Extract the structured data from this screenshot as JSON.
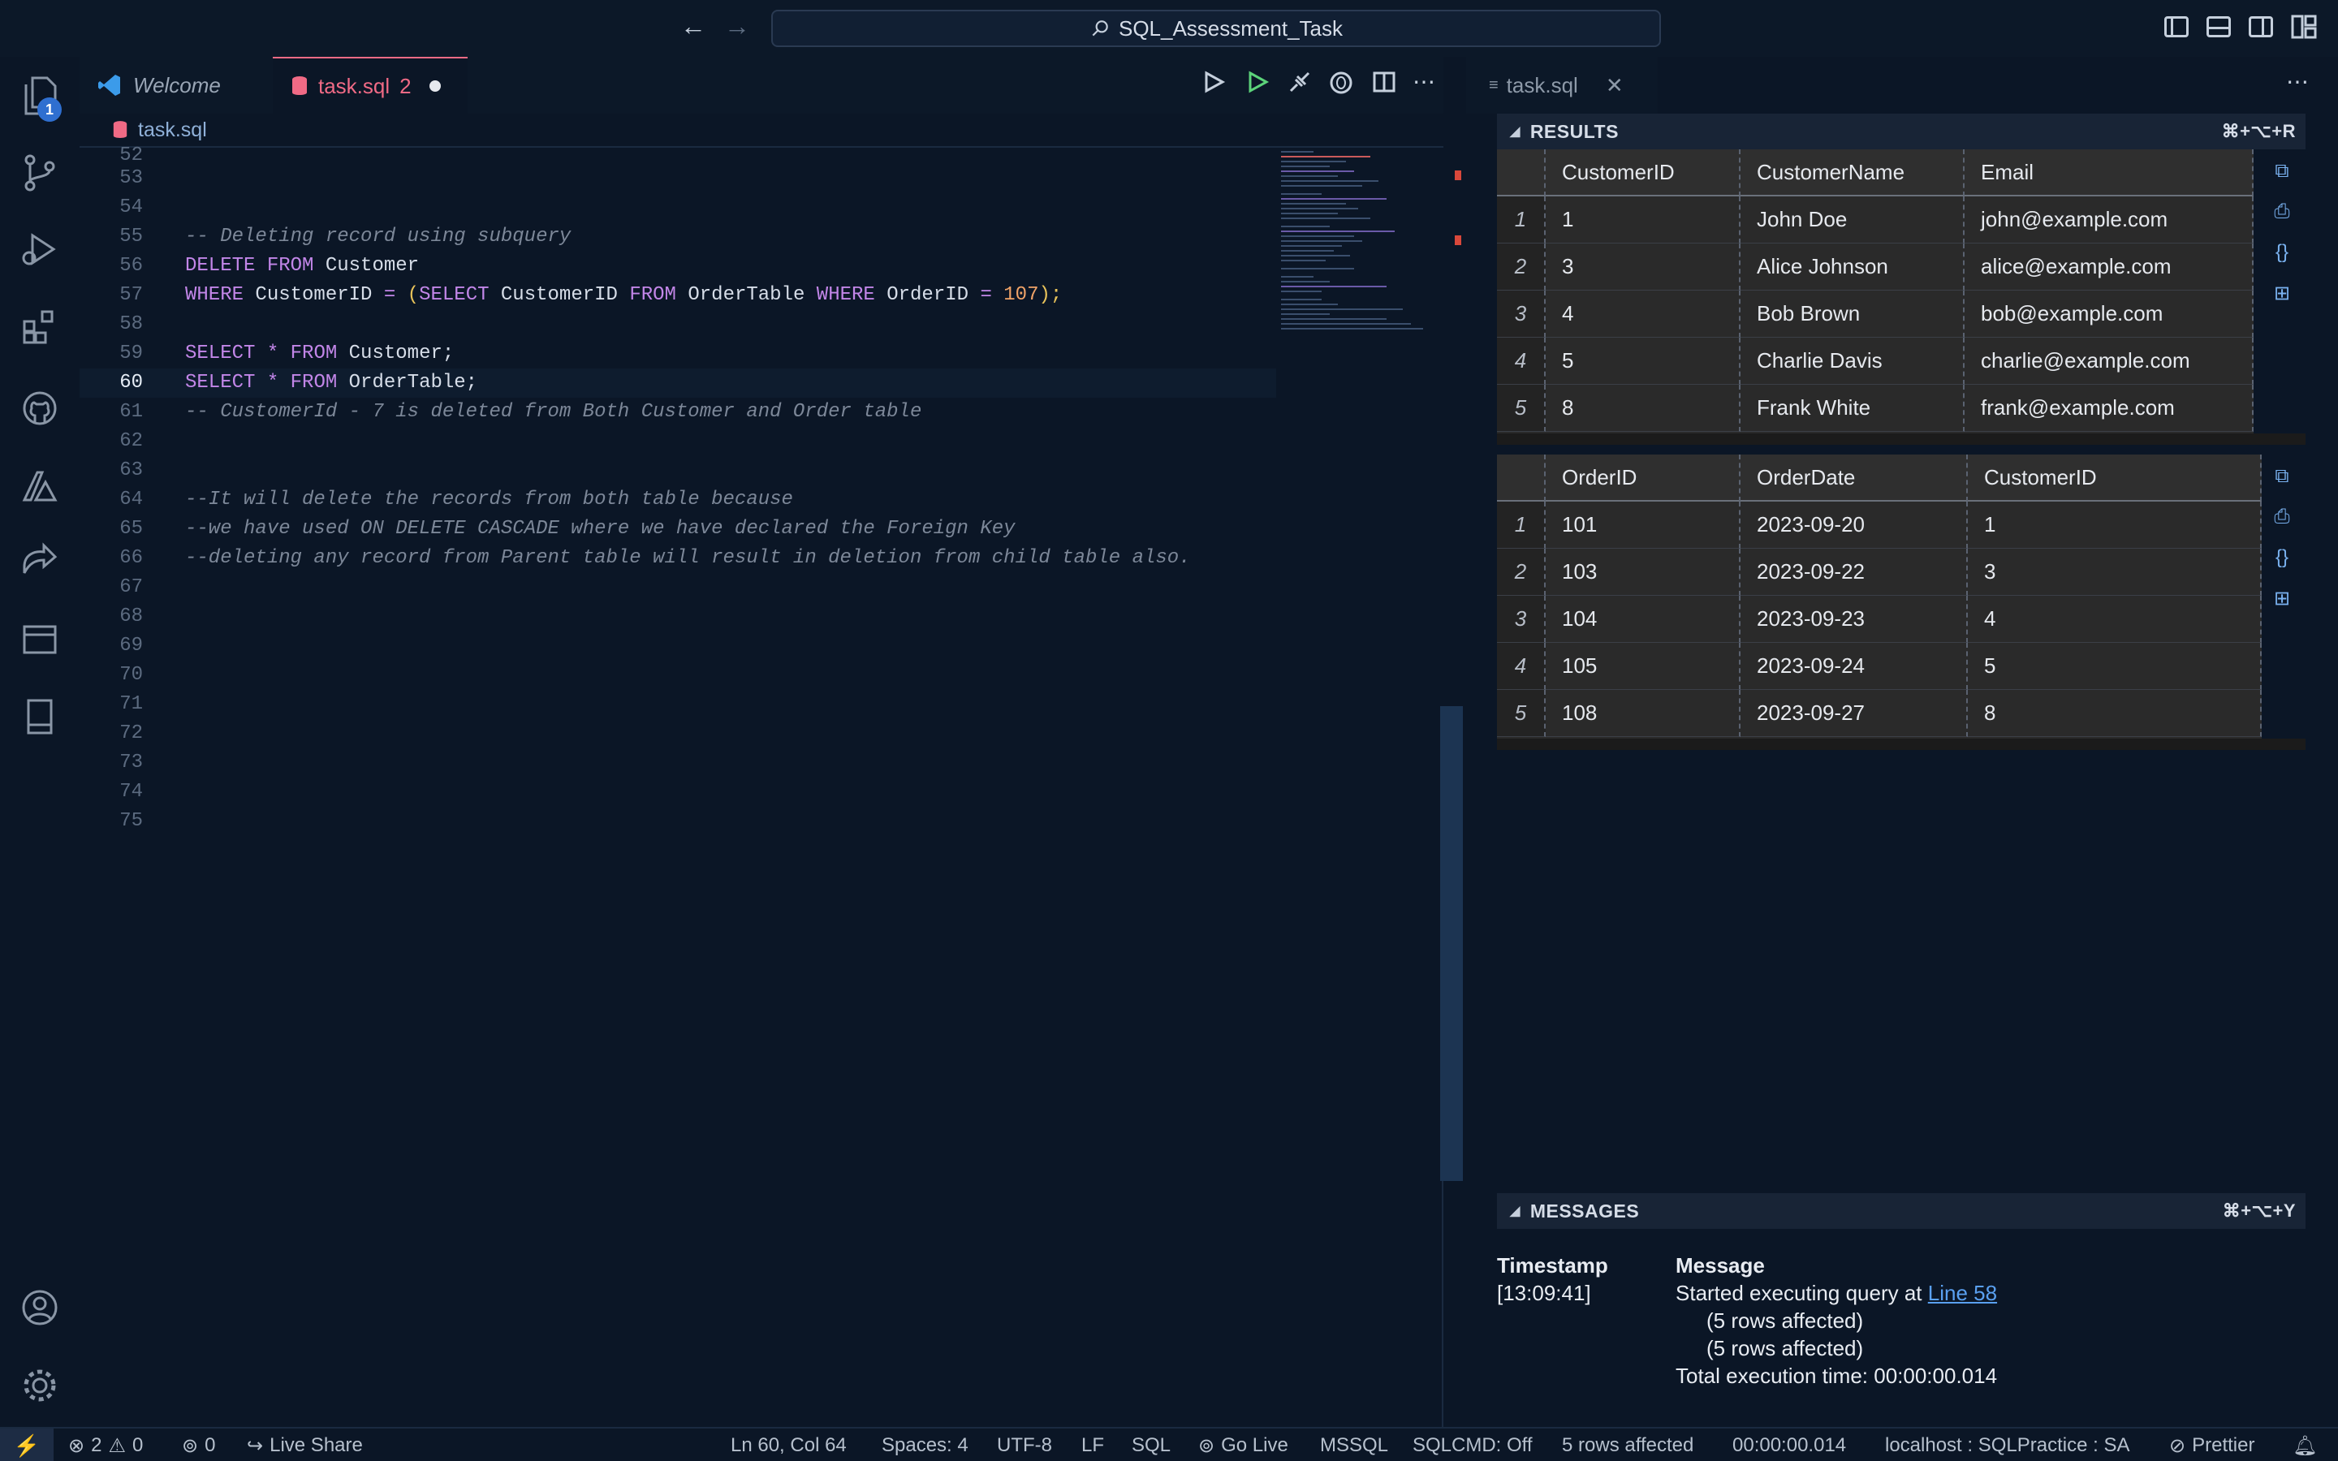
{
  "titlebar": {
    "search_text": "SQL_Assessment_Task"
  },
  "activity": {
    "explorer_badge": "1"
  },
  "tabs": {
    "welcome": "Welcome",
    "task": "task.sql",
    "task_problems": "2",
    "right_tab": "task.sql"
  },
  "breadcrumb": {
    "file": "task.sql"
  },
  "editor": {
    "lines": [
      {
        "n": "52"
      },
      {
        "n": "53"
      },
      {
        "n": "54"
      },
      {
        "n": "55"
      },
      {
        "n": "56"
      },
      {
        "n": "57"
      },
      {
        "n": "58"
      },
      {
        "n": "59"
      },
      {
        "n": "60"
      },
      {
        "n": "61"
      },
      {
        "n": "62"
      },
      {
        "n": "63"
      },
      {
        "n": "64"
      },
      {
        "n": "65"
      },
      {
        "n": "66"
      },
      {
        "n": "67"
      },
      {
        "n": "68"
      },
      {
        "n": "69"
      },
      {
        "n": "70"
      },
      {
        "n": "71"
      },
      {
        "n": "72"
      },
      {
        "n": "73"
      },
      {
        "n": "74"
      },
      {
        "n": "75"
      }
    ],
    "code": {
      "l54": "-- Deleting record using subquery",
      "l55_kw1": "DELETE",
      "l55_kw2": "FROM",
      "l55_id": "Customer",
      "l56_kw1": "WHERE",
      "l56_id1": "CustomerID",
      "l56_op": "=",
      "l56_open": "(",
      "l56_kw2": "SELECT",
      "l56_id2": "CustomerID",
      "l56_kw3": "FROM",
      "l56_id3": "OrderTable",
      "l56_kw4": "WHERE",
      "l56_id4": "OrderID",
      "l56_op2": "=",
      "l56_num": "107",
      "l56_close": ");",
      "l58_kw1": "SELECT",
      "l58_star": "*",
      "l58_kw2": "FROM",
      "l58_id": "Customer;",
      "l59_kw1": "SELECT",
      "l59_star": "*",
      "l59_kw2": "FROM",
      "l59_id": "OrderTable;",
      "l60": "-- CustomerId - 7 is deleted from Both Customer and Order table",
      "l63": "--It will delete the records from both table because",
      "l64": "--we have used ON DELETE CASCADE where we have declared the Foreign Key",
      "l65": "--deleting any record from Parent table will result in deletion from child table also."
    }
  },
  "results": {
    "title": "RESULTS",
    "shortcut": "⌘+⌥+R",
    "customer_table": {
      "headers": [
        "CustomerID",
        "CustomerName",
        "Email"
      ],
      "rows": [
        {
          "idx": "1",
          "c1": "1",
          "c2": "John Doe",
          "c3": "john@example.com"
        },
        {
          "idx": "2",
          "c1": "3",
          "c2": "Alice Johnson",
          "c3": "alice@example.com"
        },
        {
          "idx": "3",
          "c1": "4",
          "c2": "Bob Brown",
          "c3": "bob@example.com"
        },
        {
          "idx": "4",
          "c1": "5",
          "c2": "Charlie Davis",
          "c3": "charlie@example.com"
        },
        {
          "idx": "5",
          "c1": "8",
          "c2": "Frank White",
          "c3": "frank@example.com"
        }
      ]
    },
    "order_table": {
      "headers": [
        "OrderID",
        "OrderDate",
        "CustomerID"
      ],
      "rows": [
        {
          "idx": "1",
          "c1": "101",
          "c2": "2023-09-20",
          "c3": "1"
        },
        {
          "idx": "2",
          "c1": "103",
          "c2": "2023-09-22",
          "c3": "3"
        },
        {
          "idx": "3",
          "c1": "104",
          "c2": "2023-09-23",
          "c3": "4"
        },
        {
          "idx": "4",
          "c1": "105",
          "c2": "2023-09-24",
          "c3": "5"
        },
        {
          "idx": "5",
          "c1": "108",
          "c2": "2023-09-27",
          "c3": "8"
        }
      ]
    }
  },
  "messages": {
    "title": "MESSAGES",
    "shortcut": "⌘+⌥+Y",
    "col_timestamp": "Timestamp",
    "col_message": "Message",
    "timestamp": "[13:09:41]",
    "started": "Started executing query at",
    "line_link": "Line 58",
    "affected1": "(5 rows affected)",
    "affected2": "(5 rows affected)",
    "total": "Total execution time: 00:00:00.014"
  },
  "statusbar": {
    "errors": "2",
    "warnings": "0",
    "ports": "0",
    "live_share": "Live Share",
    "position": "Ln 60, Col 64",
    "spaces": "Spaces: 4",
    "encoding": "UTF-8",
    "eol": "LF",
    "language": "SQL",
    "go_live": "Go Live",
    "mssql": "MSSQL",
    "sqlcmd": "SQLCMD: Off",
    "rows": "5 rows affected",
    "time": "00:00:00.014",
    "connection": "localhost : SQLPractice : SA",
    "prettier": "Prettier"
  },
  "colors": {
    "background": "#0b1626",
    "accent_tab": "#f06a85",
    "keyword": "#c286e8",
    "number": "#f0a368",
    "link": "#5aa0f0"
  }
}
